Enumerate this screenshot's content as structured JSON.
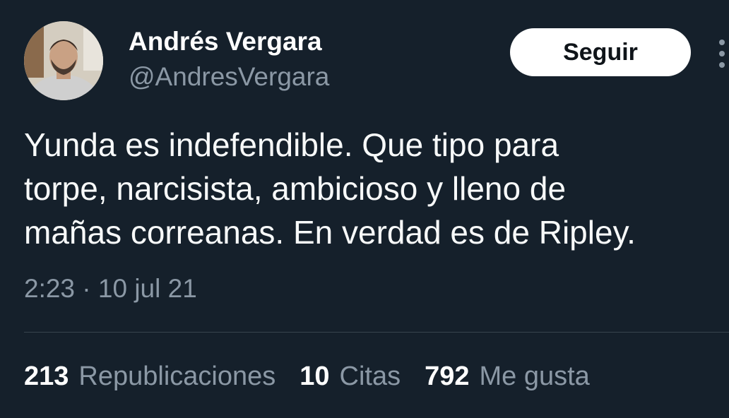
{
  "author": {
    "display_name": "Andrés Vergara",
    "handle": "@AndresVergara",
    "avatar_icon": "profile-photo"
  },
  "follow_button": {
    "label": "Seguir"
  },
  "more_button": {
    "icon": "more-options-icon"
  },
  "tweet": {
    "text": "Yunda es indefendible. Que tipo para\ntorpe, narcisista, ambicioso y lleno de\nmañas correanas. En verdad es de Ripley.",
    "time": "2:23",
    "separator": "·",
    "date": "10 jul 21"
  },
  "stats": {
    "reposts": {
      "count": "213",
      "label": "Republicaciones"
    },
    "quotes": {
      "count": "10",
      "label": "Citas"
    },
    "likes": {
      "count": "792",
      "label": "Me gusta"
    }
  },
  "colors": {
    "background": "#15202b",
    "primary_text": "#ffffff",
    "secondary_text": "#8b98a5",
    "divider": "#38444d",
    "button_bg": "#ffffff"
  }
}
